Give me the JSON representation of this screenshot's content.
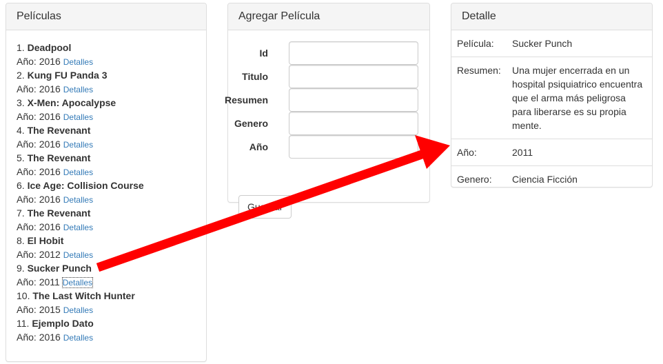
{
  "peliculas_panel": {
    "title": "Películas",
    "year_prefix": "Año:",
    "link_label": "Detalles",
    "movies": [
      {
        "num": "1.",
        "title": "Deadpool",
        "year": "2016"
      },
      {
        "num": "2.",
        "title": "Kung FU Panda 3",
        "year": "2016"
      },
      {
        "num": "3.",
        "title": "X-Men: Apocalypse",
        "year": "2016"
      },
      {
        "num": "4.",
        "title": "The Revenant",
        "year": "2016"
      },
      {
        "num": "5.",
        "title": "The Revenant",
        "year": "2016"
      },
      {
        "num": "6.",
        "title": "Ice Age: Collision Course",
        "year": "2016"
      },
      {
        "num": "7.",
        "title": "The Revenant",
        "year": "2016"
      },
      {
        "num": "8.",
        "title": "El Hobit",
        "year": "2012"
      },
      {
        "num": "9.",
        "title": "Sucker Punch",
        "year": "2011"
      },
      {
        "num": "10.",
        "title": "The Last Witch Hunter",
        "year": "2015"
      },
      {
        "num": "11.",
        "title": "Ejemplo Dato",
        "year": "2016"
      }
    ],
    "focused_index": 8
  },
  "agregar_panel": {
    "title": "Agregar Película",
    "fields": [
      {
        "label": "Id",
        "value": ""
      },
      {
        "label": "Titulo",
        "value": ""
      },
      {
        "label": "Resumen",
        "value": ""
      },
      {
        "label": "Genero",
        "value": ""
      },
      {
        "label": "Año",
        "value": ""
      }
    ],
    "save_label": "Guardar"
  },
  "detalle_panel": {
    "title": "Detalle",
    "rows": [
      {
        "key": "Película:",
        "value": "Sucker Punch"
      },
      {
        "key": "Resumen:",
        "value": "Una mujer encerrada en un hospital psiquiatrico encuentra que el arma más peligrosa para liberarse es su propia mente."
      },
      {
        "key": "Año:",
        "value": "2011"
      },
      {
        "key": "Genero:",
        "value": "Ciencia Ficción"
      }
    ]
  },
  "colors": {
    "link": "#337ab7",
    "annotation_arrow": "#ff0000",
    "panel_border": "#dddddd",
    "panel_heading_bg": "#f5f5f5"
  }
}
